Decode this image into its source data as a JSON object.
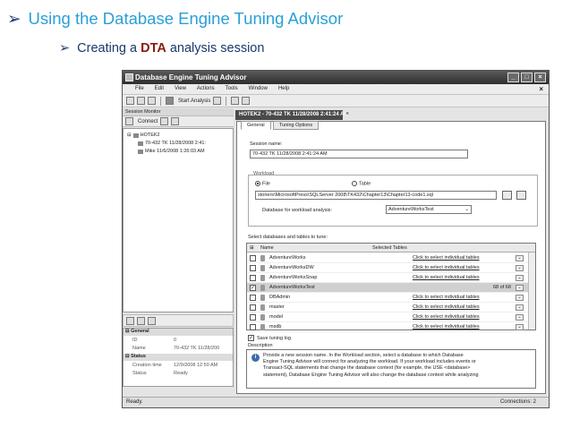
{
  "slide": {
    "heading_bullet": "➢",
    "heading": "Using the Database Engine Tuning Advisor",
    "sub_bullet": "➢",
    "sub_prefix": "Creating a ",
    "sub_emphasis": "DTA",
    "sub_suffix": " analysis session"
  },
  "window": {
    "title": "Database Engine Tuning Advisor",
    "controls": [
      "_",
      "□",
      "×"
    ]
  },
  "menu": {
    "items": [
      "File",
      "Edit",
      "View",
      "Actions",
      "Tools",
      "Window",
      "Help"
    ],
    "close": "×"
  },
  "toolbar": {
    "start_analysis": "Start Analysis"
  },
  "session_monitor": {
    "title": "Session Monitor",
    "connect": "Connect",
    "server": "HOTEK2",
    "sessions": [
      "70-432 TK 11/28/2008 2:41:",
      "Mike 11/6/2008 1:26:03 AM"
    ]
  },
  "properties": {
    "general": "General",
    "id_key": "ID",
    "id_val": "0",
    "name_key": "Name",
    "name_val": "70-432 TK 11/28/200",
    "status": "Status",
    "created_key": "Creation time",
    "created_val": "12/9/2008 12:50 AM",
    "status_key": "Status",
    "status_val": "Ready"
  },
  "document": {
    "tab_title": "HOTEK2 - 70-432 TK 11/28/2008 2:41:24 AM",
    "close": "×",
    "tabs": [
      "General",
      "Tuning Options"
    ],
    "session_name_label": "Session name:",
    "session_name": "70-432 TK 11/28/2008 2:41:24 AM",
    "workload_label": "Workload",
    "file_label": "File",
    "table_label": "Table",
    "workload_file": "stoners\\MicrosoftPress\\SQLServer 2008\\TK432\\Chapter13\\Chapter13-code1.sql",
    "db_label": "Database for workload analysis:",
    "db_value": "AdventureWorksTest",
    "select_label": "Select databases and tables to tune:",
    "col_name": "Name",
    "col_tables": "Selected Tables",
    "databases": [
      {
        "name": "AdventureWorks",
        "tables": "Click to select individual tables",
        "checked": false
      },
      {
        "name": "AdventureWorksDW",
        "tables": "Click to select individual tables",
        "checked": false
      },
      {
        "name": "AdventureWorksSnap",
        "tables": "Click to select individual tables",
        "checked": false
      },
      {
        "name": "AdventureWorksTest",
        "tables": "68 of 68",
        "checked": true
      },
      {
        "name": "DBAdmin",
        "tables": "Click to select individual tables",
        "checked": false
      },
      {
        "name": "master",
        "tables": "Click to select individual tables",
        "checked": false
      },
      {
        "name": "model",
        "tables": "Click to select individual tables",
        "checked": false
      },
      {
        "name": "msdb",
        "tables": "Click to select individual tables",
        "checked": false
      }
    ],
    "save_log": "Save tuning log",
    "description_label": "Description",
    "description_lines": [
      "Provide a new session name. In the Workload section, select a database to which Database",
      "Engine Tuning Advisor will connect for analyzing the workload. If your workload includes events or",
      "Transact-SQL statements that change the database context (for example, the USE <database>",
      "statement), Database Engine Tuning Advisor will also change the database context while analyzing"
    ]
  },
  "statusbar": {
    "left": "Ready.",
    "right": "Connections: 2"
  }
}
